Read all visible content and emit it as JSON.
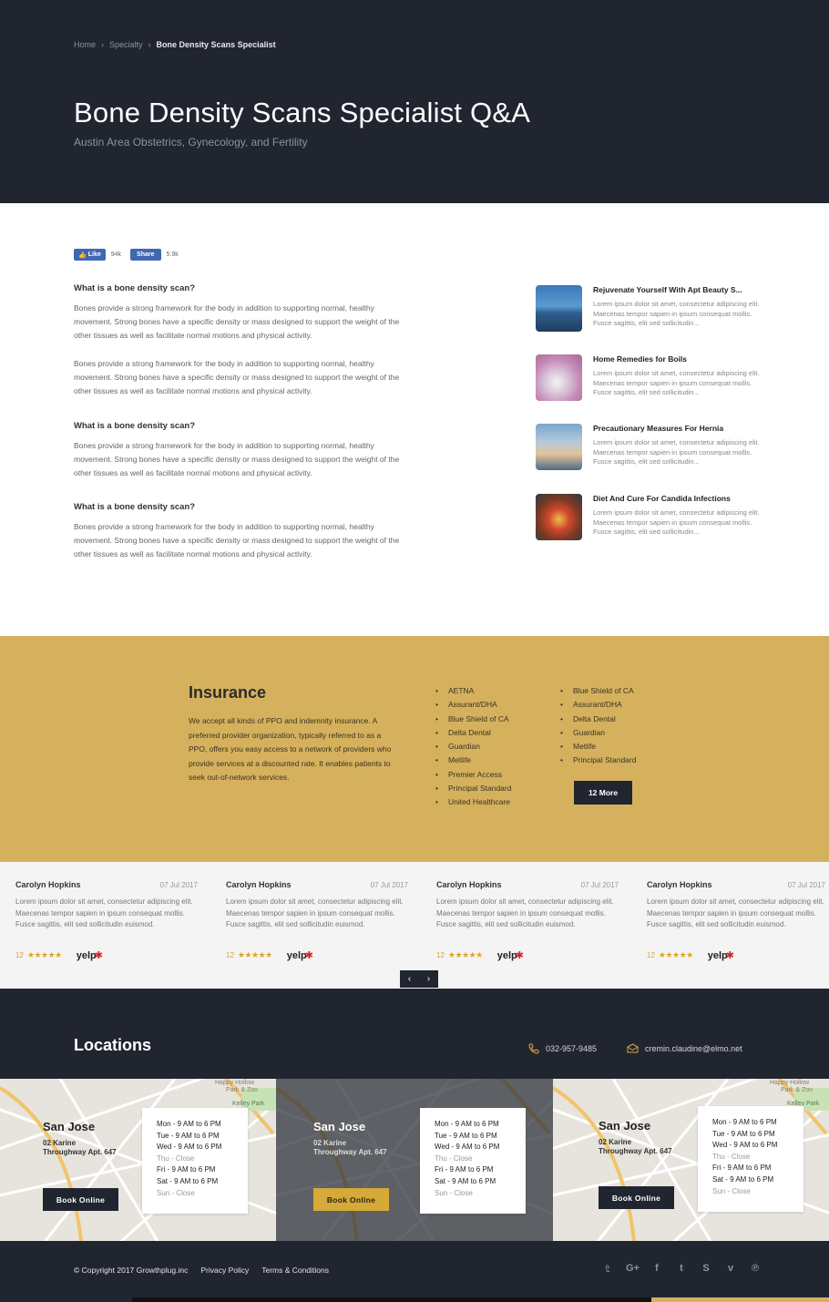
{
  "breadcrumb": {
    "home": "Home",
    "specialty": "Specialty",
    "current": "Bone Density Scans Specialist"
  },
  "hero": {
    "title": "Bone Density Scans Specialist Q&A",
    "subtitle": "Austin Area Obstetrics, Gynecology, and Fertility"
  },
  "social": {
    "like_label": "Like",
    "like_count": "94k",
    "share_label": "Share",
    "share_count": "5.9k"
  },
  "qa": [
    {
      "question": "What is a bone density scan?",
      "answer": "Bones provide a strong framework for the body in addition to supporting normal, healthy movement. Strong bones have a specific density or mass designed to support the weight of the other tissues as well as facilitate normal motions and physical activity.",
      "answer2": "Bones provide a strong framework for the body in addition to supporting normal, healthy movement. Strong bones have a specific density or mass designed to support the weight of the other tissues as well as facilitate normal motions and physical activity."
    },
    {
      "question": "What is a bone density scan?",
      "answer": "Bones provide a strong framework for the body in addition to supporting normal, healthy movement. Strong bones have a specific density or mass designed to support the weight of the other tissues as well as facilitate normal motions and physical activity."
    },
    {
      "question": "What is a bone density scan?",
      "answer": "Bones provide a strong framework for the body in addition to supporting normal, healthy movement. Strong bones have a specific density or mass designed to support the weight of the other tissues as well as facilitate normal motions and physical activity."
    }
  ],
  "articles": [
    {
      "title": "Rejuvenate Yourself With Apt Beauty S...",
      "excerpt": "Lorem ipsum dolor sit amet, consectetur adipiscing elit. Maecenas tempor sapien in ipsum consequat mollis. Fusce sagittis, elit sed sollicitudin..."
    },
    {
      "title": "Home Remedies for Boils",
      "excerpt": "Lorem ipsum dolor sit amet, consectetur adipiscing elit. Maecenas tempor sapien in ipsum consequat mollis. Fusce sagittis, elit sed sollicitudin..."
    },
    {
      "title": "Precautionary Measures For Hernia",
      "excerpt": "Lorem ipsum dolor sit amet, consectetur adipiscing elit. Maecenas tempor sapien in ipsum consequat mollis. Fusce sagittis, elit sed sollicitudin..."
    },
    {
      "title": "Diet And Cure For Candida Infections",
      "excerpt": "Lorem ipsum dolor sit amet, consectetur adipiscing elit. Maecenas tempor sapien in ipsum consequat mollis. Fusce sagittis, elit sed sollicitudin..."
    }
  ],
  "insurance": {
    "title": "Insurance",
    "text": "We accept all kinds of PPO and indemnity insurance. A preferred provider organization, typically referred to as a PPO, offers you easy access to a network of providers who provide services at a discounted rate. It enables patients to seek out-of-network services.",
    "list1": [
      "AETNA",
      "Assurant/DHA",
      "Blue Shield of CA",
      "Delta Dental",
      "Guardian",
      "Metlife",
      "Premier Access",
      "Principal Standard",
      "United Healthcare"
    ],
    "list2": [
      "Blue Shield of CA",
      "Assurant/DHA",
      "Delta Dental",
      "Guardian",
      "Metlife",
      "Principal Standard"
    ],
    "more_label": "12 More"
  },
  "reviews": [
    {
      "name": "Carolyn Hopkins",
      "date": "07 Jul 2017",
      "text": "Lorem ipsum dolor sit amet, consectetur adipiscing elit. Maecenas tempor sapien in ipsum consequat mollis. Fusce sagittis, elit sed sollicitudin euismod.",
      "score": "12",
      "stars": "★★★★★",
      "source": "yelp"
    },
    {
      "name": "Carolyn Hopkins",
      "date": "07 Jul 2017",
      "text": "Lorem ipsum dolor sit amet, consectetur adipiscing elit. Maecenas tempor sapien in ipsum consequat mollis. Fusce sagittis, elit sed sollicitudin euismod.",
      "score": "12",
      "stars": "★★★★★",
      "source": "yelp"
    },
    {
      "name": "Carolyn Hopkins",
      "date": "07 Jul 2017",
      "text": "Lorem ipsum dolor sit amet, consectetur adipiscing elit. Maecenas tempor sapien in ipsum consequat mollis. Fusce sagittis, elit sed sollicitudin euismod.",
      "score": "12",
      "stars": "★★★★★",
      "source": "yelp"
    },
    {
      "name": "Carolyn Hopkins",
      "date": "07 Jul 2017",
      "text": "Lorem ipsum dolor sit amet, consectetur adipiscing elit. Maecenas tempor sapien in ipsum consequat mollis. Fusce sagittis, elit sed sollicitudin euismod.",
      "score": "12",
      "stars": "★★★★★",
      "source": "yelp"
    }
  ],
  "carousel": {
    "prev": "‹",
    "next": "›"
  },
  "locations": {
    "title": "Locations",
    "phone": "032-957-9485",
    "email": "cremin.claudine@elmo.net",
    "items": [
      {
        "city": "San Jose",
        "addr1": "02 Karine",
        "addr2": "Throughway Apt. 647",
        "book_label": "Book Online",
        "hours": [
          "Mon - 9 AM to 6 PM",
          "Tue - 9 AM to 6 PM",
          "Wed - 9 AM to 6 PM",
          "Thu - Close",
          "Fri - 9 AM to 6 PM",
          "Sat - 9 AM to 6 PM",
          "Sun - Close"
        ]
      },
      {
        "city": "San Jose",
        "addr1": "02 Karine",
        "addr2": "Throughway Apt. 647",
        "book_label": "Book Online",
        "hours": [
          "Mon - 9 AM to 6 PM",
          "Tue - 9 AM to 6 PM",
          "Wed - 9 AM to 6 PM",
          "Thu - Close",
          "Fri - 9 AM to 6 PM",
          "Sat - 9 AM to 6 PM",
          "Sun - Close"
        ]
      },
      {
        "city": "San Jose",
        "addr1": "02 Karine",
        "addr2": "Throughway Apt. 647",
        "book_label": "Book Online",
        "hours": [
          "Mon - 9 AM to 6 PM",
          "Tue - 9 AM to 6 PM",
          "Wed - 9 AM to 6 PM",
          "Thu - Close",
          "Fri - 9 AM to 6 PM",
          "Sat - 9 AM to 6 PM",
          "Sun - Close"
        ]
      }
    ],
    "map_labels": [
      "Happy Hollow Park & Zoo",
      "Kelley Park"
    ]
  },
  "footer": {
    "copyright": "© Copyright 2017 Growthplug.inc",
    "privacy": "Privacy Policy",
    "terms": "Terms & Conditions",
    "social_icons": [
      "twitter-icon",
      "google-plus-icon",
      "facebook-icon",
      "tumblr-icon",
      "skype-icon",
      "vimeo-icon",
      "pinterest-icon"
    ],
    "social_glyphs": [
      "𝕥",
      "G+",
      "f",
      "t",
      "S",
      "v",
      "℗"
    ]
  },
  "colors": {
    "dark": "#202530",
    "gold": "#d5b15e",
    "accent_gold": "#d5a93a",
    "light_bg": "#f4f4f5"
  }
}
